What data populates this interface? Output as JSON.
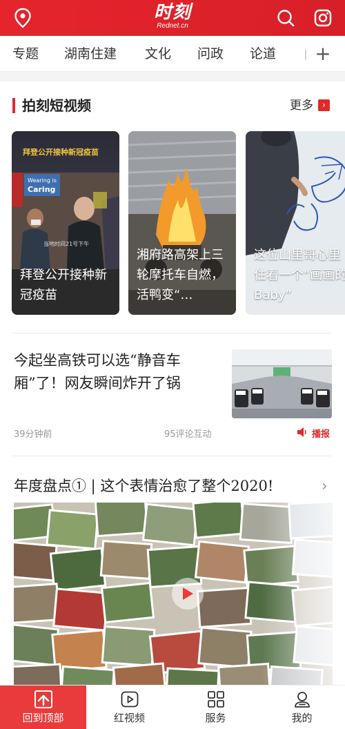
{
  "header": {
    "logo_text": "时刻",
    "logo_subtext": "Rednet.cn",
    "icons": [
      "location-icon",
      "search-icon",
      "instagram-icon"
    ],
    "background": "#e4252d"
  },
  "channels": {
    "items": [
      "专题",
      "湖南住建",
      "文化",
      "问政",
      "论道"
    ],
    "overflow": "丨",
    "add_label": "+"
  },
  "section": {
    "title": "拍刻短视频",
    "more_label": "更多",
    "more_icon": "›",
    "accent": "#e02a2a"
  },
  "videos": [
    {
      "caption": "拜登公开接种新冠疫苗",
      "banner": "拜登公开接种新冠疫苗",
      "sign_line1": "Wearing is",
      "sign_line2": "Caring",
      "stamp": "当地时间21号下午"
    },
    {
      "caption": "湘府路高架上三轮摩托车自燃，活鸭变“…"
    },
    {
      "caption": "这位山里哥心里住着一个“画画的Baby”"
    }
  ],
  "article1": {
    "title": "今起坐高铁可以选“静音车厢”了！网友瞬间炸开了锅",
    "time": "39分钟前",
    "comments": "95评论互动",
    "play_label": "播报"
  },
  "article2": {
    "title": "年度盘点① | 这个表情治愈了整个2020!",
    "chevron": "›"
  },
  "bottom_nav": [
    {
      "label": "回到顶部",
      "icon": "back-to-top-icon",
      "active": true
    },
    {
      "label": "红视频",
      "icon": "video-play-icon"
    },
    {
      "label": "服务",
      "icon": "grid-icon"
    },
    {
      "label": "我的",
      "icon": "user-icon"
    }
  ]
}
